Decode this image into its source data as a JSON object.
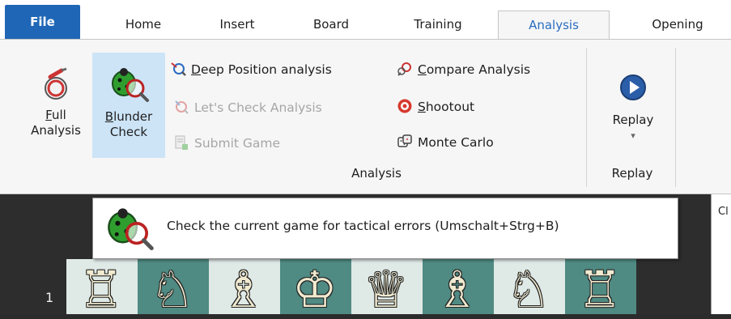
{
  "tabs": [
    {
      "label": "File"
    },
    {
      "label": "Home"
    },
    {
      "label": "Insert"
    },
    {
      "label": "Board"
    },
    {
      "label": "Training"
    },
    {
      "label": "Analysis"
    },
    {
      "label": "Opening"
    }
  ],
  "ribbon": {
    "full_analysis": {
      "line1_ul": "F",
      "line1_rest": "ull",
      "line2": "Analysis"
    },
    "blunder_check": {
      "line1_ul": "B",
      "line1_rest": "lunder",
      "line2": "Check"
    },
    "deep_position": {
      "ul": "D",
      "rest": "eep Position analysis"
    },
    "lets_check": {
      "label": "Let's Check Analysis"
    },
    "submit_game": {
      "label": "Submit Game"
    },
    "compare_analysis": {
      "ul": "C",
      "rest": "ompare Analysis"
    },
    "shootout": {
      "ul": "S",
      "rest": "hootout"
    },
    "monte_carlo": {
      "label": "Monte Carlo"
    },
    "replay": {
      "label": "Replay",
      "arrow": "▾"
    },
    "group_analysis": "Analysis",
    "group_replay": "Replay"
  },
  "tooltip": {
    "text": "Check the current game for tactical errors (Umschalt+Strg+B)"
  },
  "side_panel": {
    "label": "Cl"
  },
  "board": {
    "rank_label": "1",
    "pieces": [
      "♖",
      "♘",
      "♗",
      "♔",
      "♕",
      "♗",
      "♘",
      "♖"
    ]
  },
  "colors": {
    "file_tab": "#1f67b6",
    "active_tab_text": "#2a6cc0",
    "selected": "#cde4f7",
    "dark_square": "#4f8a83",
    "light_square": "#dfe9e6"
  }
}
